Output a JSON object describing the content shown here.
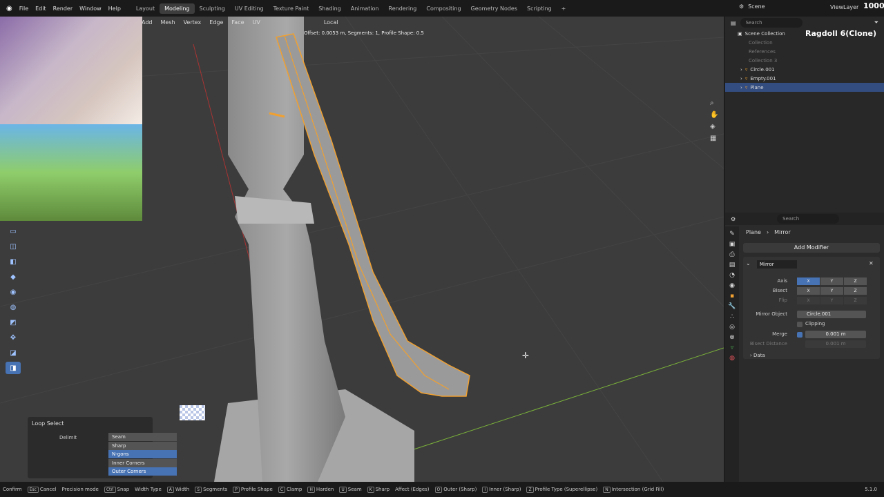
{
  "menu": [
    "File",
    "Edit",
    "Render",
    "Window",
    "Help"
  ],
  "workspaces": [
    "Layout",
    "Modeling",
    "Sculpting",
    "UV Editing",
    "Texture Paint",
    "Shading",
    "Animation",
    "Rendering",
    "Compositing",
    "Geometry Nodes",
    "Scripting"
  ],
  "active_workspace": "Modeling",
  "scene": {
    "scene_name": "Scene",
    "view_layer": "ViewLayer"
  },
  "viewport_header": {
    "items": [
      "Add",
      "Mesh",
      "Vertex",
      "Edge",
      "Face",
      "UV"
    ],
    "transform": "Local"
  },
  "operator_text": "Offset: 0.0053 m, Segments: 1, Profile Shape: 0.5",
  "overlay": {
    "ragdoll": "Ragdoll 6(Clone)",
    "counter": "1000"
  },
  "outliner": {
    "search_placeholder": "Search",
    "rows": [
      {
        "name": "Scene Collection"
      },
      {
        "name": "Collection"
      },
      {
        "name": "References"
      },
      {
        "name": "Collection 3"
      },
      {
        "name": "Circle.001"
      },
      {
        "name": "Empty.001"
      },
      {
        "name": "Plane"
      }
    ]
  },
  "loop_select": {
    "title": "Loop Select",
    "delimit_label": "Delimit",
    "options": [
      {
        "label": "Seam",
        "on": false
      },
      {
        "label": "Sharp",
        "on": false
      },
      {
        "label": "N-gons",
        "on": true
      },
      {
        "label": "Inner Corners",
        "on": false
      },
      {
        "label": "Outer Corners",
        "on": true
      }
    ]
  },
  "properties": {
    "search_placeholder": "Search",
    "breadcrumb": [
      "Plane",
      "Mirror"
    ],
    "add_modifier": "Add Modifier",
    "modifier_name": "Mirror",
    "axis_label": "Axis",
    "bisect_label": "Bisect",
    "flip_label": "Flip",
    "axes": [
      "X",
      "Y",
      "Z"
    ],
    "mirror_object_label": "Mirror Object",
    "mirror_object": "Circle.001",
    "clipping_label": "Clipping",
    "merge_label": "Merge",
    "merge_value": "0.001 m",
    "bisect_distance_label": "Bisect Distance",
    "bisect_distance_value": "0.001 m",
    "data_label": "Data"
  },
  "statusbar": [
    {
      "key": "",
      "label": "Confirm"
    },
    {
      "key": "Esc",
      "label": "Cancel"
    },
    {
      "key": "",
      "label": "Precision mode"
    },
    {
      "key": "Ctrl",
      "label": "Snap"
    },
    {
      "key": "",
      "label": "Width Type"
    },
    {
      "key": "A",
      "label": "Width"
    },
    {
      "key": "S",
      "label": "Segments"
    },
    {
      "key": "P",
      "label": "Profile Shape"
    },
    {
      "key": "C",
      "label": "Clamp"
    },
    {
      "key": "H",
      "label": "Harden"
    },
    {
      "key": "U",
      "label": "Seam"
    },
    {
      "key": "K",
      "label": "Sharp"
    },
    {
      "key": "",
      "label": "Affect (Edges)"
    },
    {
      "key": "O",
      "label": "Outer (Sharp)"
    },
    {
      "key": "I",
      "label": "Inner (Sharp)"
    },
    {
      "key": "Z",
      "label": "Profile Type (Superellipse)"
    },
    {
      "key": "N",
      "label": "Intersection (Grid Fill)"
    }
  ],
  "version": "5.1.0",
  "colors": {
    "accent": "#4772b3",
    "selection": "#f0a030",
    "viewport": "#3c3c3c"
  }
}
